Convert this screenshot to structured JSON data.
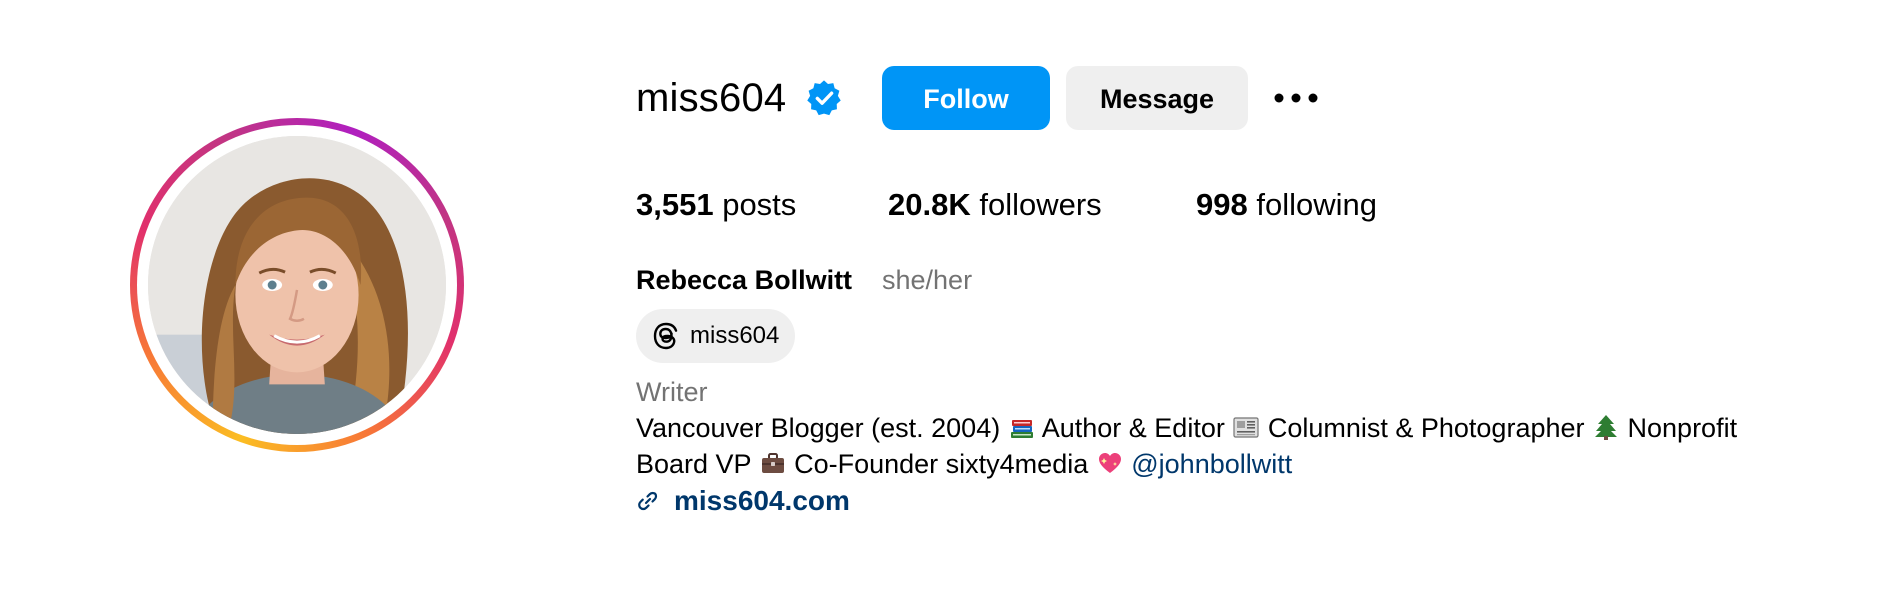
{
  "profile": {
    "username": "miss604",
    "verified": true,
    "full_name": "Rebecca Bollwitt",
    "pronouns": "she/her",
    "category": "Writer",
    "threads_handle": "miss604",
    "link": "miss604.com"
  },
  "actions": {
    "follow_label": "Follow",
    "message_label": "Message",
    "more_icon": "more-horizontal-icon"
  },
  "stats": {
    "posts_count": "3,551",
    "posts_label": "posts",
    "followers_count": "20.8K",
    "followers_label": "followers",
    "following_count": "998",
    "following_label": "following"
  },
  "bio": {
    "line1": {
      "part1": "Vancouver Blogger (est. 2004) ",
      "emoji1": "books-emoji",
      "part2": " Author & Editor ",
      "emoji2": "newspaper-emoji",
      "part3": " Columnist & Photographer ",
      "emoji3": "evergreen-tree-emoji",
      "part4": " Nonprofit"
    },
    "line2": {
      "part1": "Board VP ",
      "emoji1": "briefcase-emoji",
      "part2": " Co-Founder sixty4media ",
      "emoji2": "sparkling-heart-emoji",
      "space": " ",
      "mention": "@johnbollwitt"
    }
  },
  "colors": {
    "follow_button": "#0095f6",
    "message_button": "#efefef",
    "verified_badge": "#0095f6",
    "link": "#00376b",
    "secondary_text": "#737373"
  }
}
